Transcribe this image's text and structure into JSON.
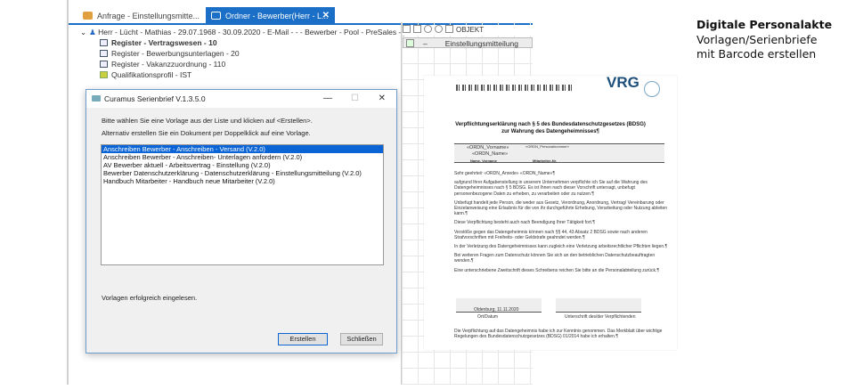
{
  "tabs": [
    {
      "label": "Anfrage - Einstellungsmitte...",
      "active": false
    },
    {
      "label": "Ordner - Bewerber(Herr - L...",
      "active": true
    }
  ],
  "tree": {
    "root": "Herr - Lücht - Mathias - 29.07.1968 - 30.09.2020 - E-Mail -  -  - Bewerber - Pool - PreSales - ja -",
    "items": [
      "Register - Vertragswesen - 10",
      "Register - Bewerbungsunterlagen - 20",
      "Register - Vakanzzuordnung - 110",
      "Qualifikationsprofil - IST"
    ]
  },
  "toolbar": {
    "objekt": "OBJEKT",
    "column": "Einstellungsmitteilung",
    "dash": "–"
  },
  "dialog": {
    "title": "Curamus Serienbrief V.1.3.5.0",
    "instruction1": "Bitte wählen Sie eine Vorlage aus der Liste und klicken auf <Erstellen>.",
    "instruction2": "Alternativ erstellen Sie ein Dokument per Doppelklick auf eine Vorlage.",
    "templates": [
      "Anschreiben Bewerber - Anschreiben - Versand (V.2.0)",
      "Anschreiben Bewerber - Anschreiben- Unterlagen anfordern (V.2.0)",
      "AV Bewerber aktuell - Arbeitsvertrag - Einstellung (V.2.0)",
      "Bewerber Datenschutzerklärung - Datenschutzerklärung - Einstellungsmitteilung (V.2.0)",
      "Handbuch Mitarbeiter - Handbuch neue Mitarbeiter (V.2.0)"
    ],
    "selected_index": 0,
    "status": "Vorlagen erfolgreich eingelesen.",
    "create": "Erstellen",
    "close": "Schließen"
  },
  "document": {
    "logo": "VRG",
    "title1": "Verpflichtungserklärung nach § 5 des Bundesdatenschutzgesetzes (BDSG)",
    "title2": "zur Wahrung des Datengeheimnisses¶",
    "field_vorname": "«ORDN_Vorname»",
    "field_name": "«ORDN_Name»",
    "field_persnr": "«ORDN_Personalnummer»",
    "label_name": "Name, Vorname",
    "label_mitarb": "Mitarbeiter-Nr.",
    "salutation": "Sehr geehrte/r «ORDN_Anrede» «ORDN_Name»¶",
    "paragraphs": [
      "aufgrund Ihrer Aufgabenstellung in unserem Unternehmen verpflichte ich Sie auf die Wahrung des Datengeheimnisses nach § 5 BDSG. Es ist Ihnen nach dieser Vorschrift untersagt, unbefugt personenbezogene Daten zu erheben, zu verarbeiten oder zu nutzen.¶",
      "Unbefugt handelt jede Person, die weder aus Gesetz, Verordnung, Anordnung, Vertrag/ Vereinbarung oder Einzelanweisung eine Erlaubnis für die von ihr durchgeführte Erhebung, Verarbeitung oder Nutzung ableiten kann.¶",
      "Diese Verpflichtung besteht auch nach Beendigung Ihrer Tätigkeit fort.¶",
      "Verstöße gegen das Datengeheimnis können nach §§ 44, 43 Absatz 2 BDSG sowie nach anderen Strafvorschriften mit Freiheits- oder Geldstrafe geahndet werden.¶",
      "In der Verletzung des Datengeheimnisses kann zugleich eine Verletzung arbeitsrechtlicher Pflichten liegen.¶",
      "Bei weiteren Fragen zum Datenschutz können Sie sich an den betrieblichen Datenschutzbeauftragten wenden.¶",
      "Eine unterschriebene Zweitschrift dieses Schreibens reichen Sie bitte an die Personalabteilung zurück.¶"
    ],
    "place_date": "Oldenburg, 11.11.2020",
    "label_place": "Ort/Datum",
    "label_sign": "Unterschrift des/der Verpflichtenden",
    "closing": "Die Verpflichtung auf das Datengeheimnis habe ich zur Kenntnis genommen. Das Merkblatt über wichtige Regelungen des Bundesdatenschutzgesetzes (BDSG) 01/2014 habe ich erhalten.¶"
  },
  "side": {
    "heading": "Digitale Personalakte",
    "line1": "Vorlagen/Serienbriefe",
    "line2": "mit Barcode erstellen"
  },
  "colors": {
    "accent": "#1b6fc7",
    "selection": "#0a64d6",
    "logo": "#1d4f7a"
  }
}
